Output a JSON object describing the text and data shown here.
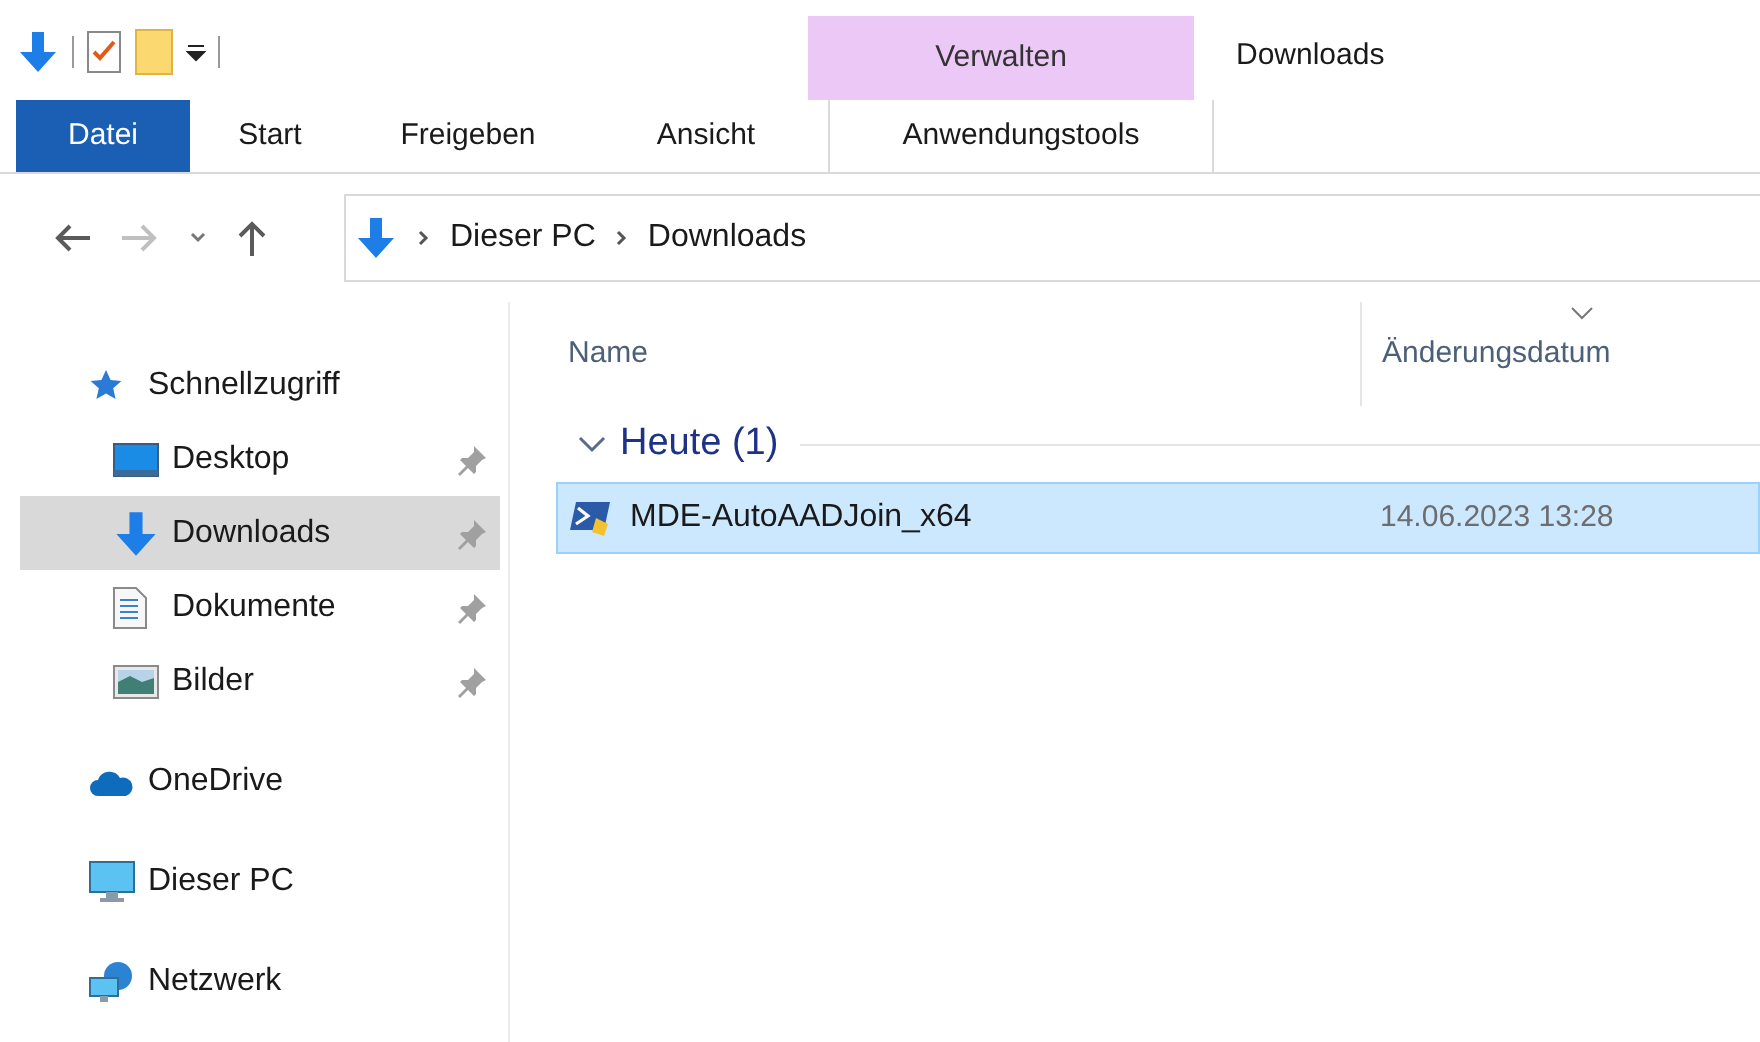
{
  "window": {
    "title": "Downloads"
  },
  "ribbon": {
    "context_group": "Verwalten",
    "tabs": [
      {
        "label": "Datei",
        "kind": "file",
        "selected": false
      },
      {
        "label": "Start",
        "kind": "plain",
        "selected": false
      },
      {
        "label": "Freigeben",
        "kind": "plain",
        "selected": false
      },
      {
        "label": "Ansicht",
        "kind": "plain",
        "selected": false
      },
      {
        "label": "Anwendungstools",
        "kind": "contextual",
        "selected": false
      }
    ]
  },
  "address_bar": {
    "path": [
      "Dieser PC",
      "Downloads"
    ]
  },
  "sidebar": {
    "items": [
      {
        "label": "Schnellzugriff",
        "kind": "star",
        "children": [
          {
            "label": "Desktop",
            "kind": "desktop",
            "pinned": true,
            "selected": false
          },
          {
            "label": "Downloads",
            "kind": "downloads",
            "pinned": true,
            "selected": true
          },
          {
            "label": "Dokumente",
            "kind": "documents",
            "pinned": true,
            "selected": false
          },
          {
            "label": "Bilder",
            "kind": "pictures",
            "pinned": true,
            "selected": false
          }
        ]
      },
      {
        "label": "OneDrive",
        "kind": "cloud"
      },
      {
        "label": "Dieser PC",
        "kind": "pc"
      },
      {
        "label": "Netzwerk",
        "kind": "network"
      }
    ]
  },
  "file_list": {
    "columns": [
      {
        "label": "Name",
        "sorted": false
      },
      {
        "label": "Änderungsdatum",
        "sorted": true
      }
    ],
    "groups": [
      {
        "label": "Heute (1)",
        "expanded": true,
        "rows": [
          {
            "name": "MDE-AutoAADJoin_x64",
            "date": "14.06.2023 13:28",
            "selected": true
          }
        ]
      }
    ]
  }
}
